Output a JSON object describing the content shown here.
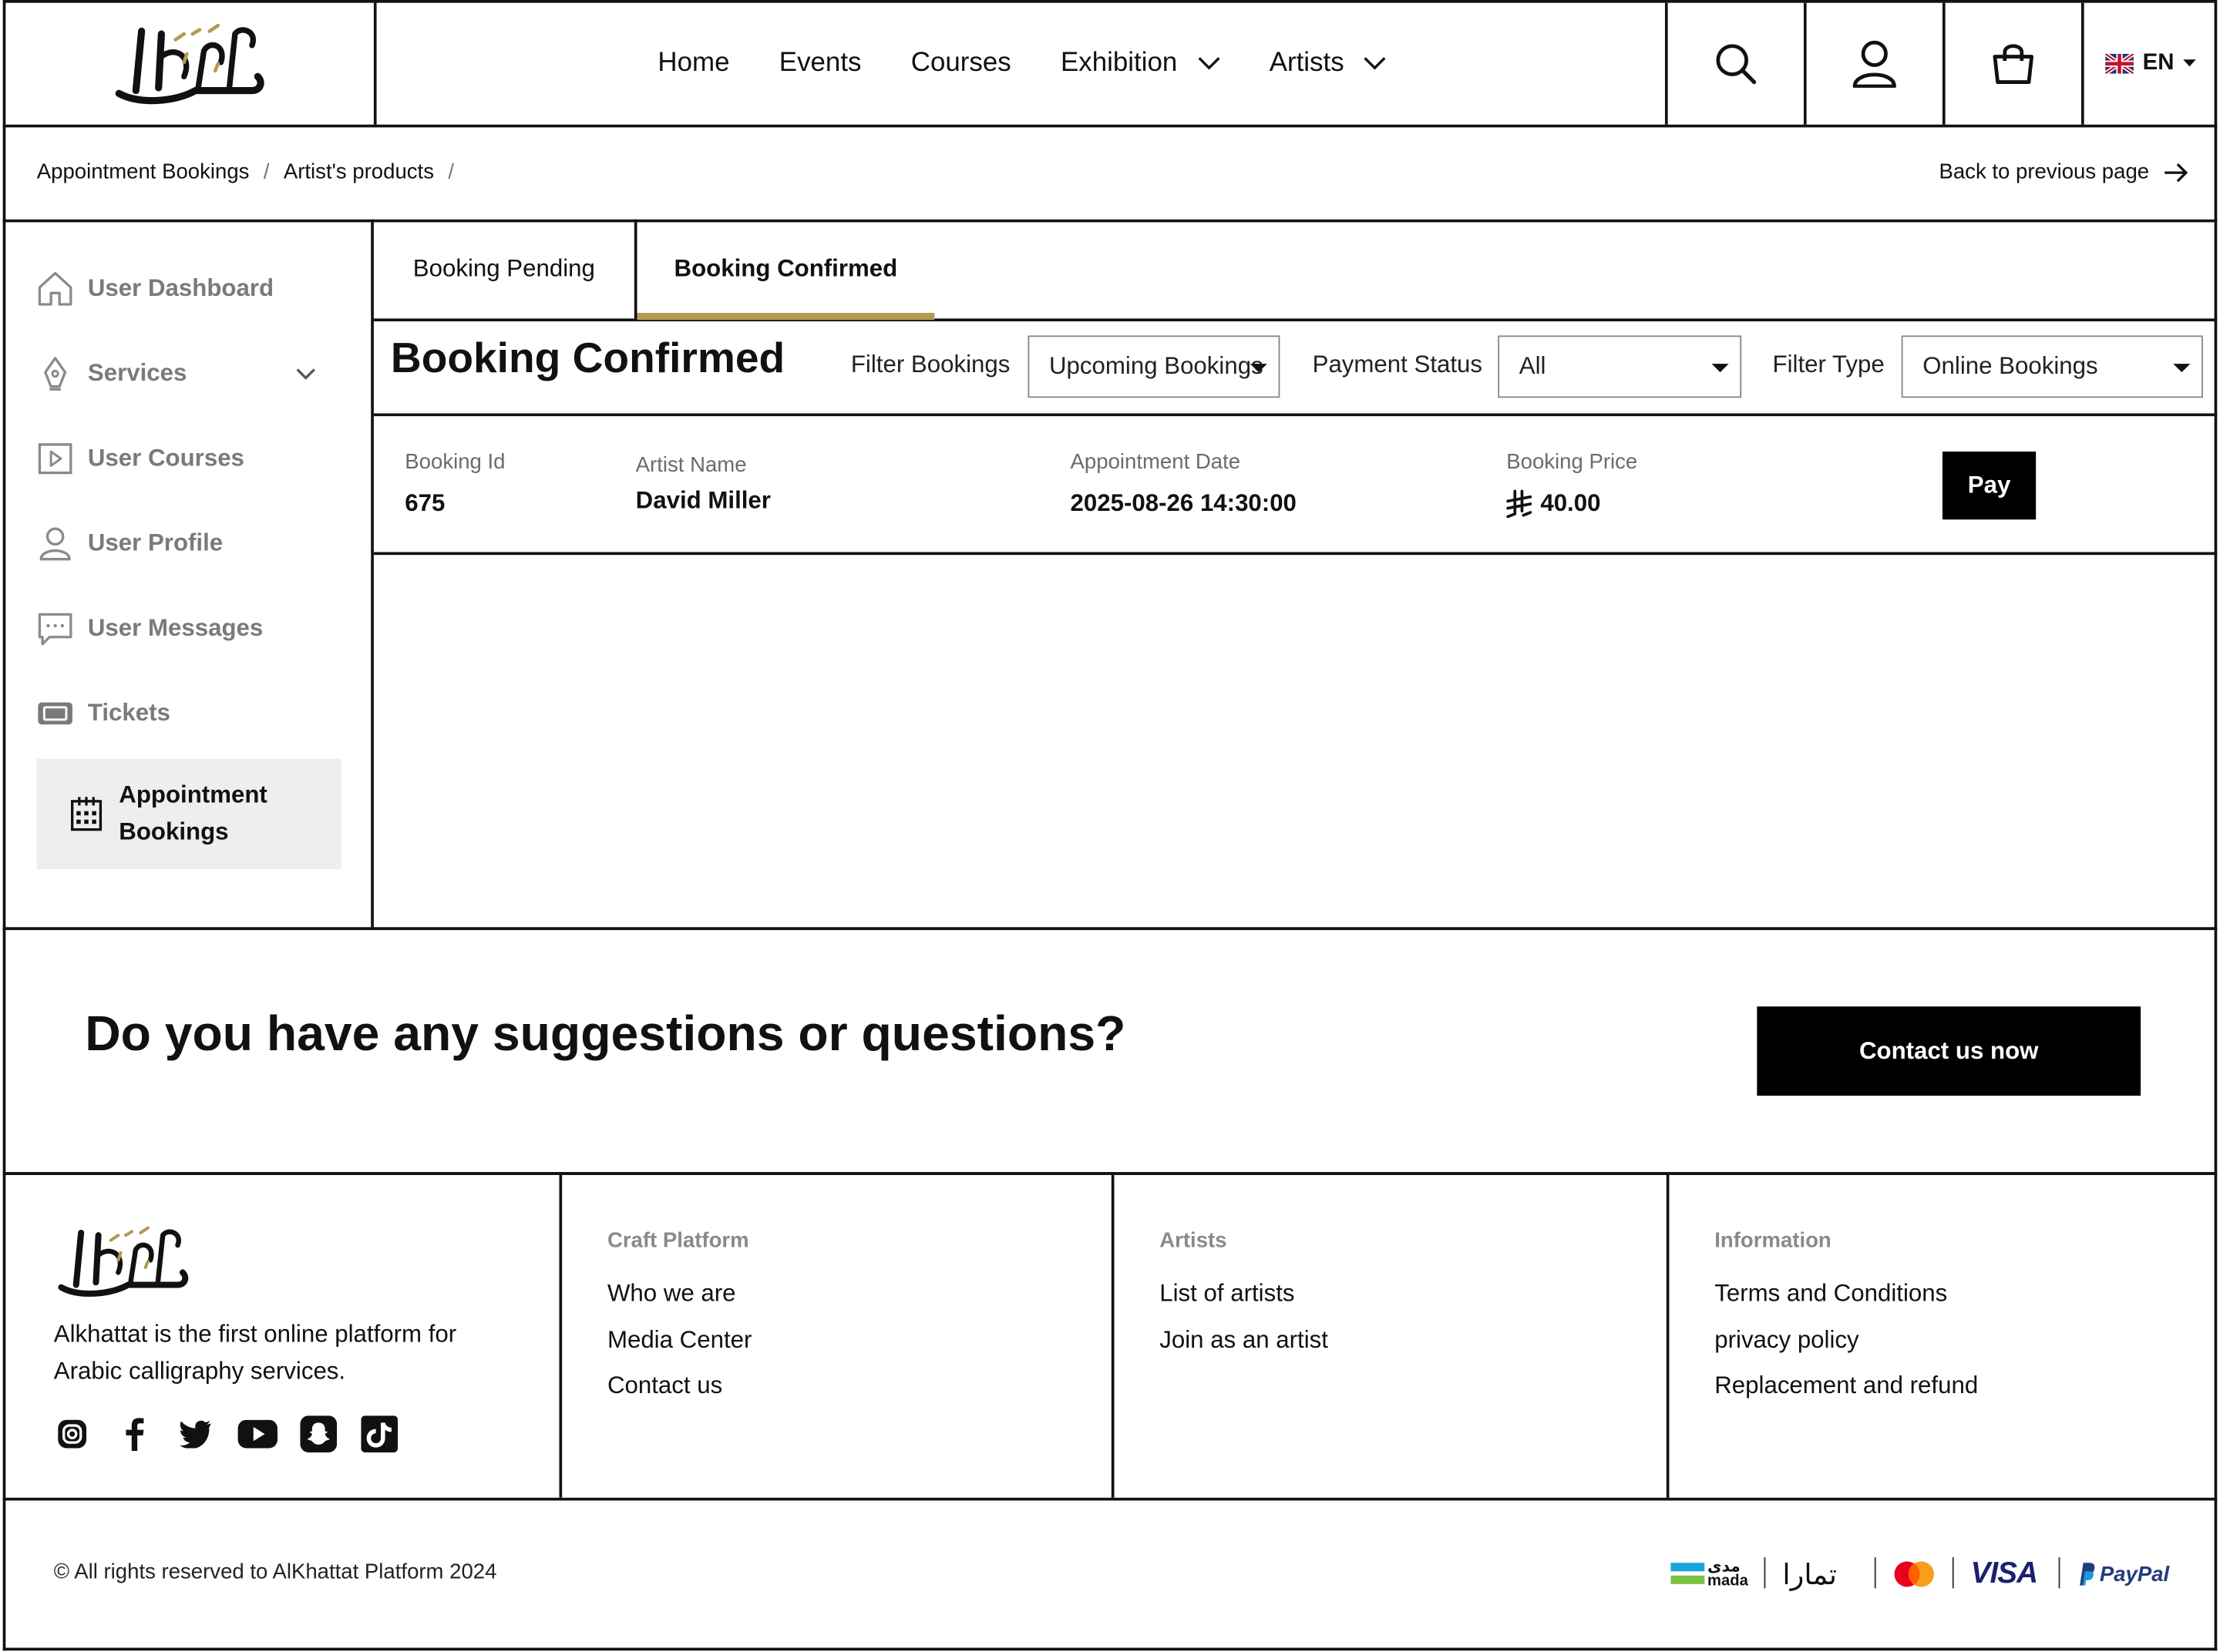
{
  "header": {
    "logo_text": "الخطاط",
    "nav": [
      {
        "label": "Home",
        "has_dropdown": false
      },
      {
        "label": "Events",
        "has_dropdown": false
      },
      {
        "label": "Courses",
        "has_dropdown": false
      },
      {
        "label": "Exhibition",
        "has_dropdown": true
      },
      {
        "label": "Artists",
        "has_dropdown": true
      }
    ],
    "icons": [
      "search-icon",
      "user-icon",
      "shopping-bag-icon"
    ],
    "language": "EN"
  },
  "breadcrumb": {
    "items": [
      "Appointment Bookings",
      "Artist's products"
    ],
    "separator": "/",
    "back_label": "Back to previous page"
  },
  "sidebar": {
    "items": [
      {
        "label": "User Dashboard",
        "icon": "home-icon"
      },
      {
        "label": "Services",
        "icon": "pen-nib-icon",
        "has_dropdown": true
      },
      {
        "label": "User Courses",
        "icon": "play-square-icon"
      },
      {
        "label": "User Profile",
        "icon": "person-icon"
      },
      {
        "label": "User Messages",
        "icon": "message-icon"
      },
      {
        "label": "Tickets",
        "icon": "ticket-icon"
      },
      {
        "label": "Appointment Bookings",
        "icon": "calendar-icon",
        "active": true
      }
    ]
  },
  "tabs": {
    "pending": "Booking Pending",
    "confirmed": "Booking Confirmed",
    "active": "confirmed"
  },
  "filters": {
    "title": "Booking Confirmed",
    "filter_bookings_label": "Filter Bookings",
    "filter_bookings_value": "Upcoming Bookings",
    "payment_status_label": "Payment Status",
    "payment_status_value": "All",
    "filter_type_label": "Filter Type",
    "filter_type_value": "Online Bookings"
  },
  "booking": {
    "id_label": "Booking Id",
    "id": "675",
    "artist_label": "Artist Name",
    "artist": "David Miller",
    "date_label": "Appointment Date",
    "date": "2025-08-26 14:30:00",
    "price_label": "Booking Price",
    "price": "40.00",
    "currency_icon": "saudi-riyal-icon",
    "pay_label": "Pay"
  },
  "cta": {
    "text": "Do you have any suggestions or questions?",
    "button": "Contact us now"
  },
  "footer": {
    "description": "Alkhattat is the first online platform for Arabic calligraphy services.",
    "social": [
      "instagram-icon",
      "facebook-icon",
      "twitter-icon",
      "youtube-icon",
      "snapchat-icon",
      "tiktok-icon"
    ],
    "columns": [
      {
        "heading": "Craft Platform",
        "links": [
          "Who we are",
          "Media Center",
          "Contact us"
        ]
      },
      {
        "heading": "Artists",
        "links": [
          "List of artists",
          "Join as an artist"
        ]
      },
      {
        "heading": "Information",
        "links": [
          "Terms and Conditions",
          "privacy policy",
          "Replacement and refund"
        ]
      }
    ],
    "copyright": "© All rights reserved to AlKhattat Platform 2024",
    "payments": {
      "mada_ar": "مدى",
      "mada_en": "mada",
      "tamara": "تمارا",
      "visa": "VISA",
      "paypal": "PayPal"
    }
  },
  "colors": {
    "accent_gold": "#b39b53",
    "active_bg": "#eeeeee",
    "muted_text": "#7a7a7a"
  }
}
